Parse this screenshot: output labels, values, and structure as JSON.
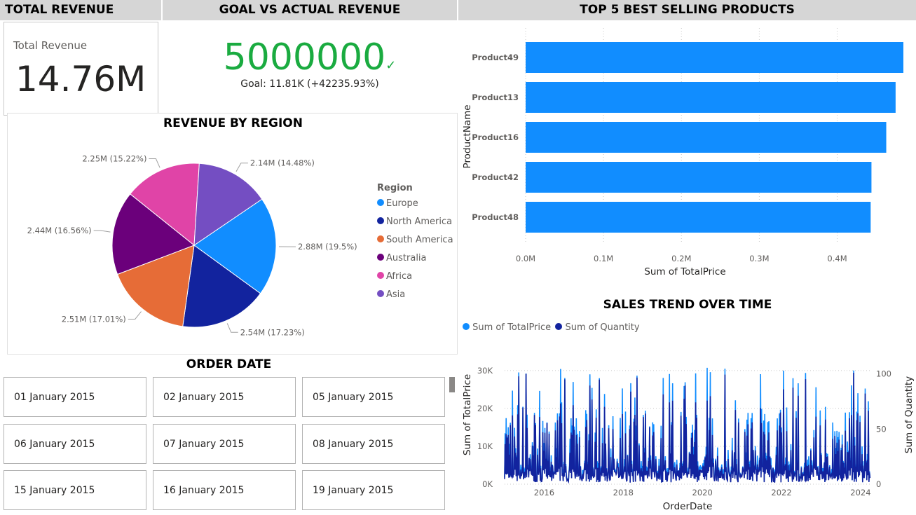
{
  "headers": {
    "total_revenue": "TOTAL REVENUE",
    "goal_vs_actual": "GOAL VS ACTUAL REVENUE",
    "top5": "TOP 5 BEST SELLING PRODUCTS"
  },
  "kpi_card": {
    "label": "Total Revenue",
    "value": "14.76M"
  },
  "goal_card": {
    "value": "5000000",
    "check": "✓",
    "goal_text": "Goal: 11.81K (+42235.93%)"
  },
  "colors": {
    "header_bg": "#d6d6d6",
    "kpi_green": "#1aab40",
    "bar_blue": "#118dff",
    "dark_blue": "#12239e"
  },
  "region_chart": {
    "title": "REVENUE BY REGION",
    "chart_data": {
      "type": "pie",
      "legend_title": "Region",
      "legend_position": "right",
      "slices": [
        {
          "name": "Europe",
          "value": 2.88,
          "pct": 19.5,
          "label": "2.88M (19.5%)",
          "color": "#118dff"
        },
        {
          "name": "North America",
          "value": 2.54,
          "pct": 17.23,
          "label": "2.54M (17.23%)",
          "color": "#12239e"
        },
        {
          "name": "South America",
          "value": 2.51,
          "pct": 17.01,
          "label": "2.51M (17.01%)",
          "color": "#e66c37"
        },
        {
          "name": "Australia",
          "value": 2.44,
          "pct": 16.56,
          "label": "2.44M (16.56%)",
          "color": "#6b007b"
        },
        {
          "name": "Africa",
          "value": 2.25,
          "pct": 15.22,
          "label": "2.25M (15.22%)",
          "color": "#e044a7"
        },
        {
          "name": "Asia",
          "value": 2.14,
          "pct": 14.48,
          "label": "2.14M (14.48%)",
          "color": "#744ec2"
        }
      ]
    }
  },
  "order_date": {
    "title": "ORDER DATE",
    "items": [
      "01 January 2015",
      "02 January 2015",
      "05 January 2015",
      "06 January 2015",
      "07 January 2015",
      "08 January 2015",
      "15 January 2015",
      "16 January 2015",
      "19 January 2015"
    ]
  },
  "top5_chart": {
    "chart_data": {
      "type": "bar",
      "orientation": "horizontal",
      "categories": [
        "Product49",
        "Product13",
        "Product16",
        "Product42",
        "Product48"
      ],
      "values": [
        0.485,
        0.475,
        0.463,
        0.444,
        0.443
      ],
      "xlim": [
        0,
        0.485
      ],
      "xticks": [
        0,
        0.1,
        0.2,
        0.3,
        0.4
      ],
      "xtick_labels": [
        "0.0M",
        "0.1M",
        "0.2M",
        "0.3M",
        "0.4M"
      ],
      "xlabel": "Sum of TotalPrice",
      "ylabel": "ProductName",
      "grid": true
    }
  },
  "sales_trend": {
    "title": "SALES TREND OVER TIME",
    "chart_data": {
      "type": "line",
      "legend_position": "top-left",
      "series": [
        {
          "name": "Sum of TotalPrice",
          "axis": "left",
          "color": "#118dff"
        },
        {
          "name": "Sum of Quantity",
          "axis": "right",
          "color": "#12239e"
        }
      ],
      "x_start": 2015.0,
      "x_end": 2024.25,
      "xticks": [
        2016,
        2018,
        2020,
        2022,
        2024
      ],
      "xtick_labels": [
        "2016",
        "2018",
        "2020",
        "2022",
        "2024"
      ],
      "yticks_left": [
        0,
        10000,
        20000,
        30000
      ],
      "ytick_labels_left": [
        "0K",
        "10K",
        "20K",
        "30K"
      ],
      "ylim_left": [
        0,
        32000
      ],
      "yticks_right": [
        0,
        50,
        100
      ],
      "ytick_labels_right": [
        "0",
        "50",
        "100"
      ],
      "ylim_right": [
        0,
        110
      ],
      "xlabel": "OrderDate",
      "ylabel_left": "Sum of TotalPrice",
      "ylabel_right": "Sum of Quantity",
      "grid": true
    }
  }
}
